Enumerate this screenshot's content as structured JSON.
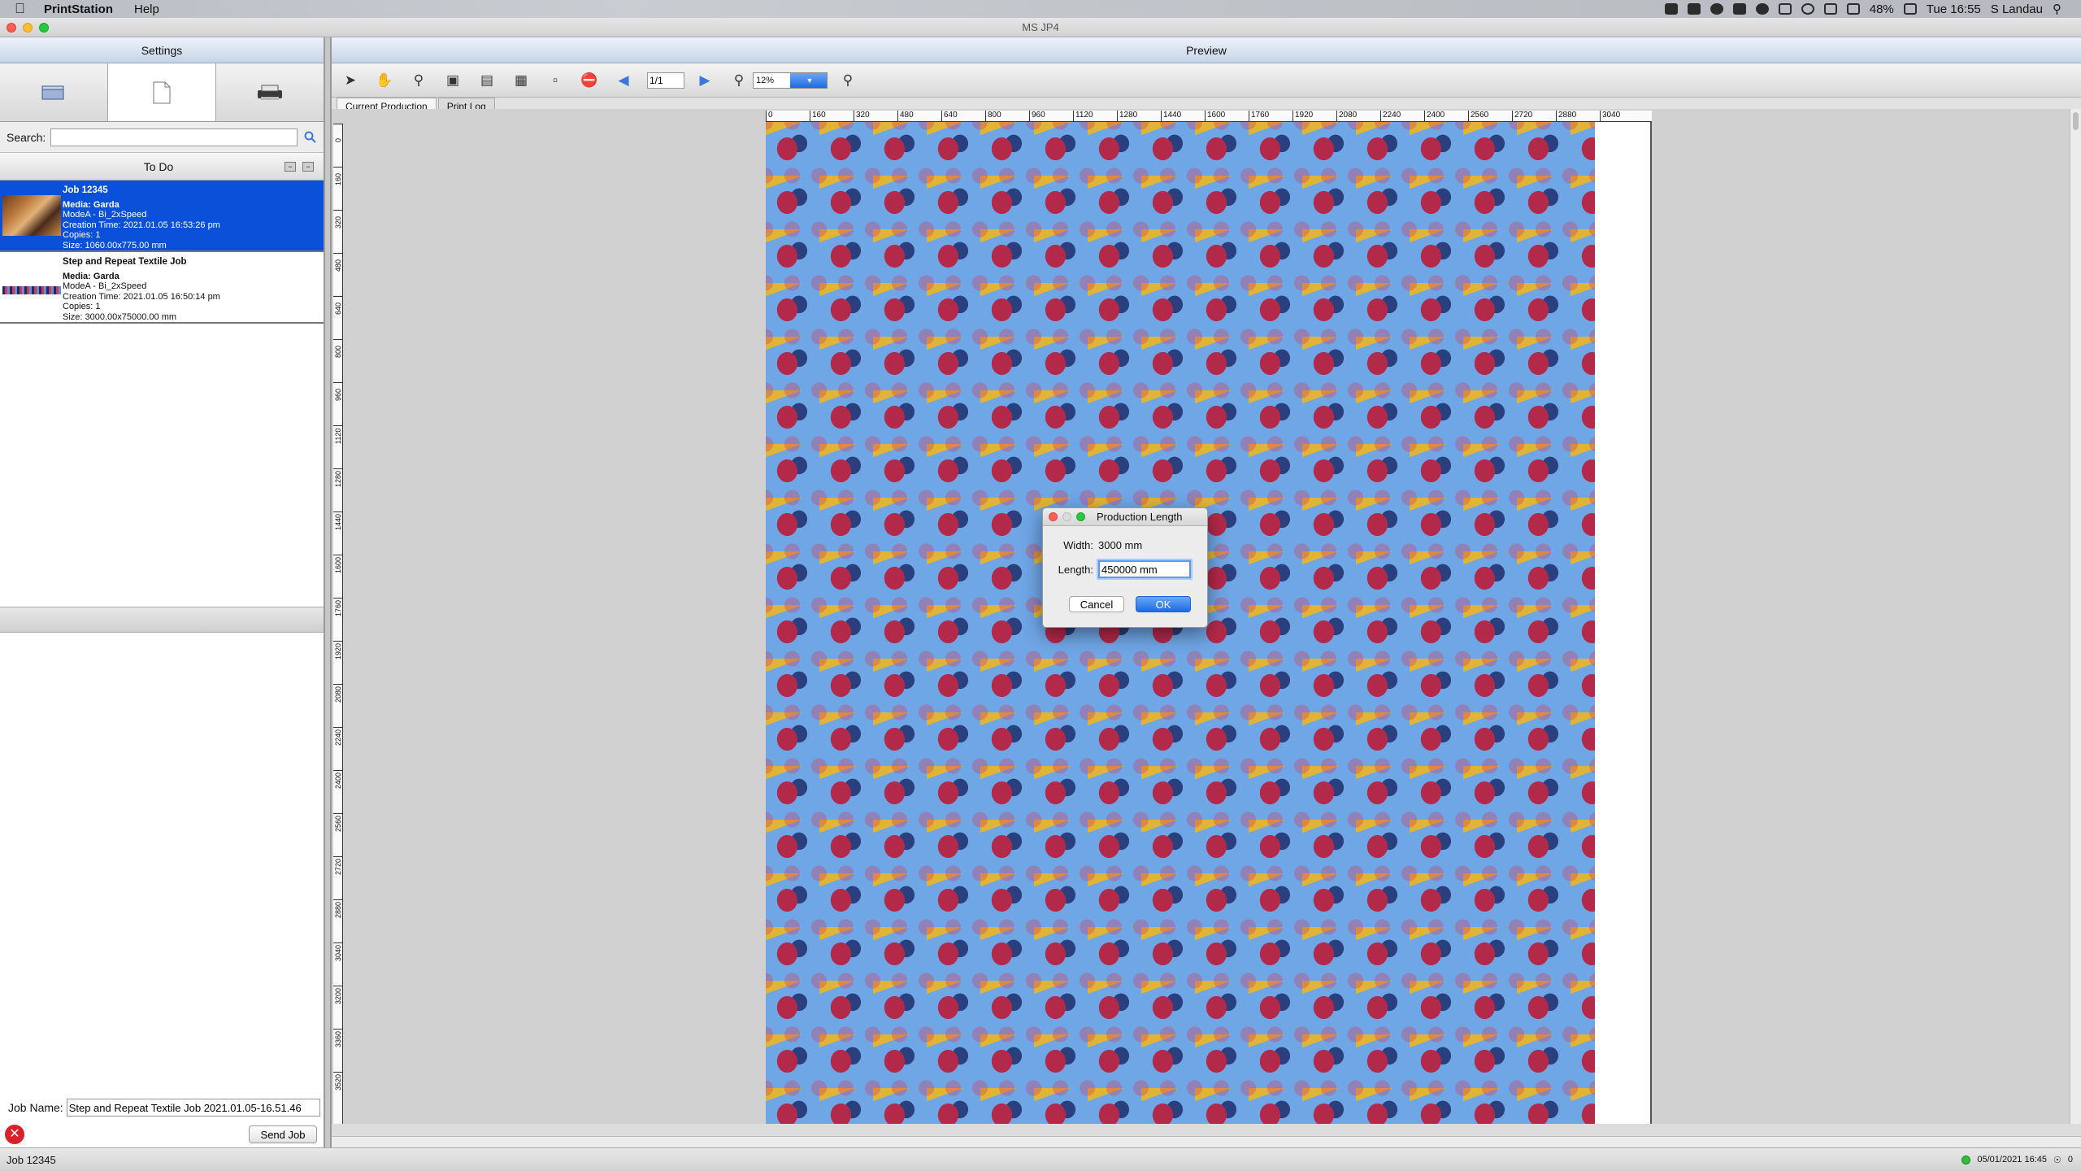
{
  "menubar": {
    "app_name": "PrintStation",
    "menus": [
      "Help"
    ],
    "battery": "48%",
    "clock": "Tue 16:55",
    "user": "S Landau"
  },
  "window": {
    "title": "MS JP4"
  },
  "left_panel": {
    "header": "Settings",
    "search_label": "Search:",
    "search_value": "",
    "todo_title": "To Do",
    "jobs": [
      {
        "title": "Job 12345",
        "media": "Media: Garda",
        "mode": "ModeA - Bi_2xSpeed",
        "created": "Creation Time: 2021.01.05 16:53:26 pm",
        "copies": "Copies: 1",
        "size": "Size: 1060.00x775.00 mm",
        "selected": true
      },
      {
        "title": "Step and Repeat Textile Job",
        "media": "Media: Garda",
        "mode": "ModeA - Bi_2xSpeed",
        "created": "Creation Time: 2021.01.05 16:50:14 pm",
        "copies": "Copies: 1",
        "size": "Size: 3000.00x75000.00 mm",
        "selected": false
      }
    ],
    "job_name_label": "Job Name:",
    "job_name_value": "Step and Repeat Textile Job 2021.01.05-16.51.46",
    "send_button": "Send Job"
  },
  "preview": {
    "header": "Preview",
    "page_field": "1/1",
    "zoom": "12%",
    "tabs": [
      "Current Production",
      "Print Log"
    ],
    "h_ruler": [
      "0",
      "160",
      "320",
      "480",
      "640",
      "800",
      "960",
      "1120",
      "1280",
      "1440",
      "1600",
      "1760",
      "1920",
      "2080",
      "2240",
      "2400",
      "2560",
      "2720",
      "2880",
      "3040"
    ],
    "v_ruler": [
      "0",
      "160",
      "320",
      "480",
      "640",
      "800",
      "960",
      "1120",
      "1280",
      "1440",
      "1600",
      "1760",
      "1920",
      "2080",
      "2240",
      "2400",
      "2560",
      "2720",
      "2880",
      "3040",
      "3200",
      "3360",
      "3520"
    ]
  },
  "dialog": {
    "title": "Production Length",
    "width_label": "Width:",
    "width_value": "3000 mm",
    "length_label": "Length:",
    "length_value": "450000 mm",
    "cancel": "Cancel",
    "ok": "OK"
  },
  "statusbar": {
    "left": "Job 12345",
    "timestamp": "05/01/2021 16:45",
    "count": "0"
  },
  "colors": {
    "selection": "#0a50d8",
    "accent": "#1c6ae6",
    "status_ok": "#2fbf3a",
    "error": "#d9212a"
  }
}
